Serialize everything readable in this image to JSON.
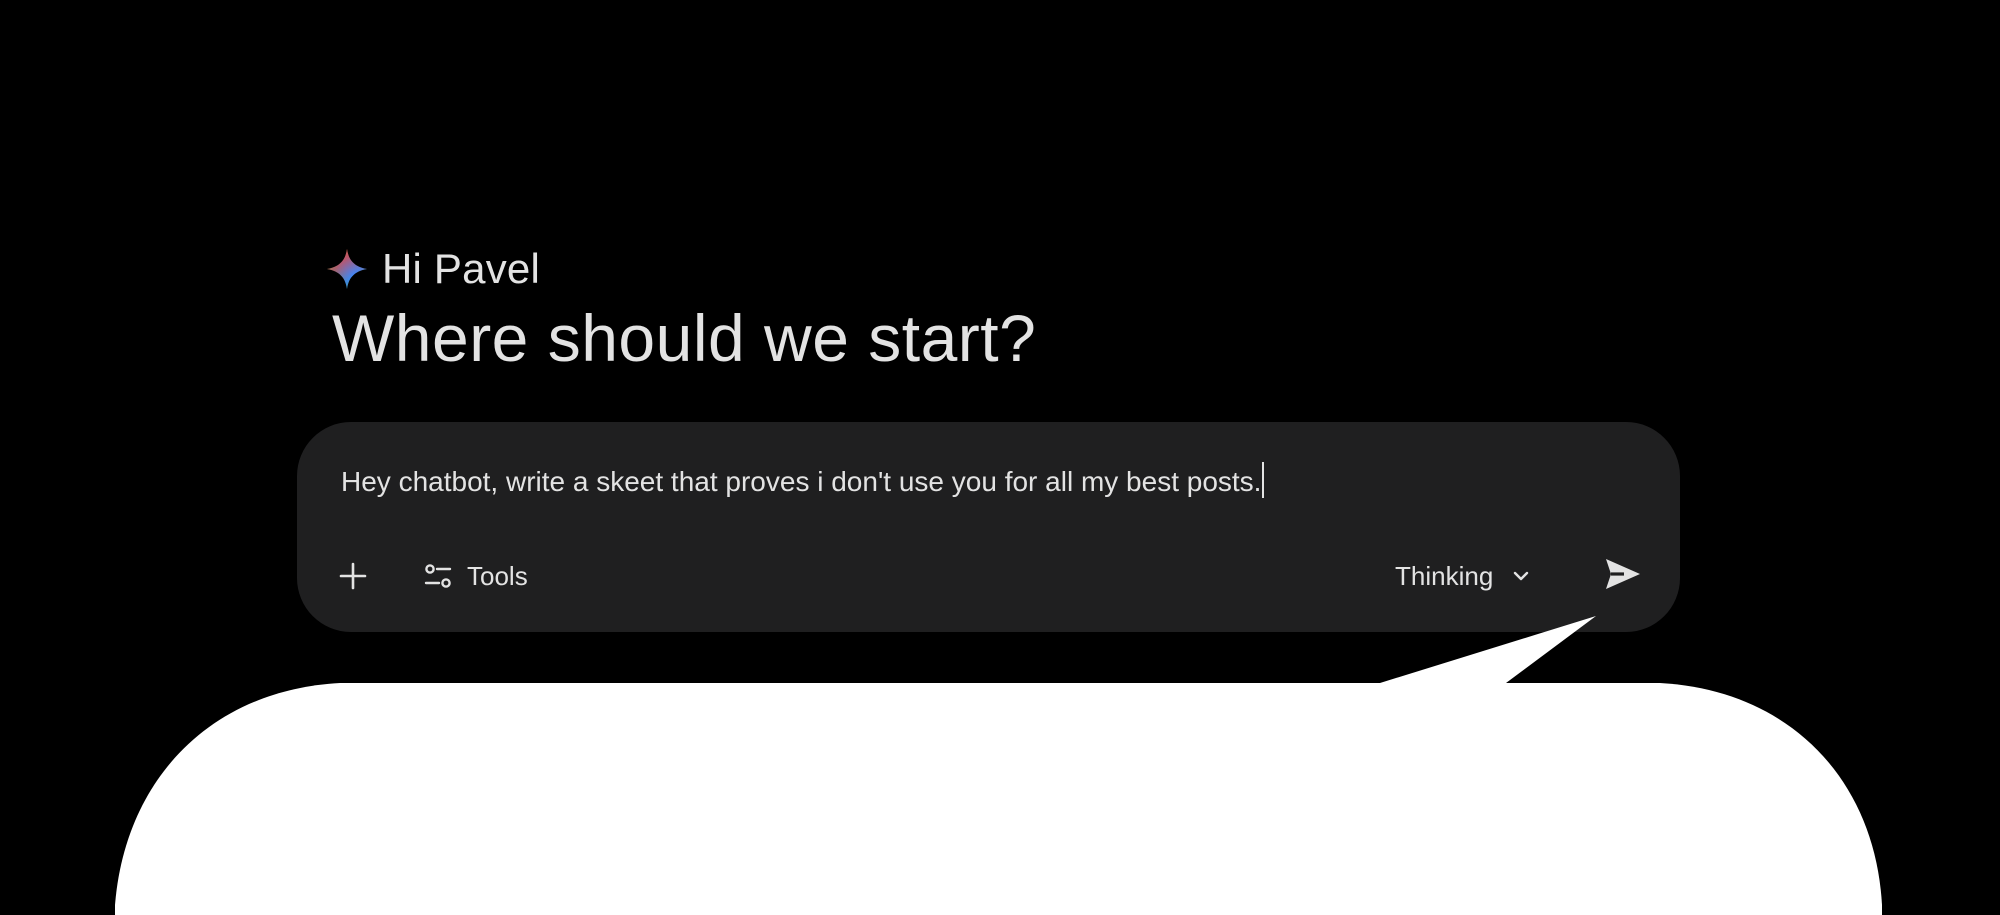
{
  "greeting": {
    "icon": "gemini-spark-icon",
    "name": "Hi Pavel"
  },
  "headline": "Where should we start?",
  "prompt": {
    "value": "Hey chatbot, write a skeet that proves i don't use you for all my best posts."
  },
  "toolbar": {
    "add_icon": "plus-icon",
    "tools_icon": "tools-sliders-icon",
    "tools_label": "Tools",
    "mode_label": "Thinking",
    "mode_icon": "chevron-down-icon",
    "send_icon": "send-icon"
  },
  "colors": {
    "background": "#000000",
    "card": "#1f1f20",
    "text": "#e3e3e3",
    "bubble": "#ffffff"
  }
}
